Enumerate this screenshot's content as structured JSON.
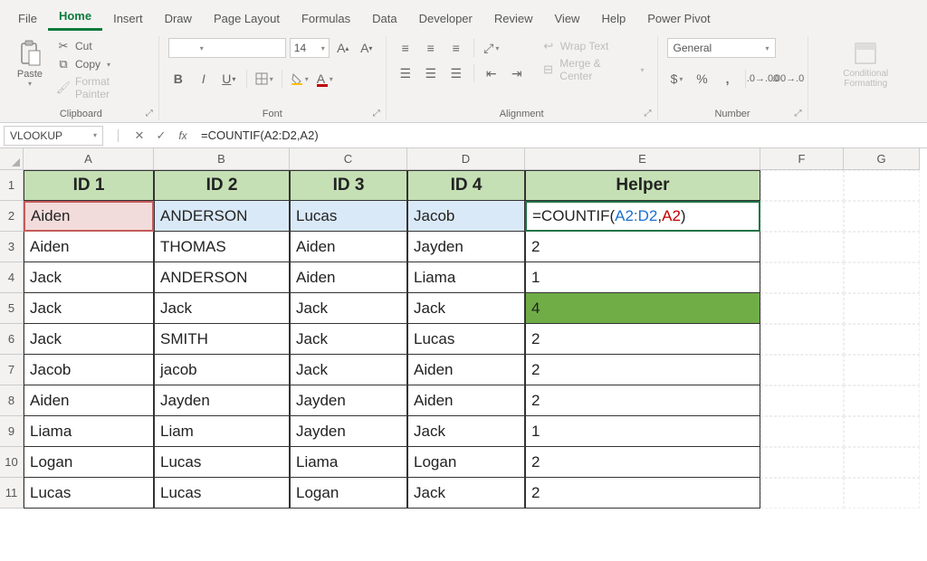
{
  "menu": [
    "File",
    "Home",
    "Insert",
    "Draw",
    "Page Layout",
    "Formulas",
    "Data",
    "Developer",
    "Review",
    "View",
    "Help",
    "Power Pivot"
  ],
  "active_tab": "Home",
  "clipboard": {
    "paste": "Paste",
    "cut": "Cut",
    "copy": "Copy",
    "format_painter": "Format Painter",
    "group": "Clipboard"
  },
  "font": {
    "size": "14",
    "group": "Font"
  },
  "alignment": {
    "wrap": "Wrap Text",
    "merge": "Merge & Center",
    "group": "Alignment"
  },
  "number": {
    "format": "General",
    "group": "Number"
  },
  "styles": {
    "cond": "Conditional Formatting"
  },
  "namebox": "VLOOKUP",
  "formula": "=COUNTIF(A2:D2,A2)",
  "columns": [
    "A",
    "B",
    "C",
    "D",
    "E",
    "F",
    "G"
  ],
  "headers": [
    "ID 1",
    "ID 2",
    "ID 3",
    "ID 4",
    "Helper"
  ],
  "e2_formula_parts": {
    "eq": "=COUNTIF(",
    "range": "A2:D2",
    "comma": ",",
    "crit": "A2",
    "close": ")"
  },
  "rows": [
    {
      "n": 2,
      "a": "Aiden",
      "b": "ANDERSON",
      "c": "Lucas",
      "d": "Jacob",
      "e": "=COUNTIF(A2:D2,A2)",
      "editing": true
    },
    {
      "n": 3,
      "a": "Aiden",
      "b": "THOMAS",
      "c": "Aiden",
      "d": "Jayden",
      "e": "2"
    },
    {
      "n": 4,
      "a": "Jack",
      "b": "ANDERSON",
      "c": "Aiden",
      "d": "Liama",
      "e": "1"
    },
    {
      "n": 5,
      "a": "Jack",
      "b": "Jack",
      "c": "Jack",
      "d": "Jack",
      "e": "4",
      "highlight": true
    },
    {
      "n": 6,
      "a": "Jack",
      "b": "SMITH",
      "c": "Jack",
      "d": "Lucas",
      "e": "2"
    },
    {
      "n": 7,
      "a": "Jacob",
      "b": "jacob",
      "c": "Jack",
      "d": "Aiden",
      "e": "2"
    },
    {
      "n": 8,
      "a": "Aiden",
      "b": "Jayden",
      "c": "Jayden",
      "d": "Aiden",
      "e": "2"
    },
    {
      "n": 9,
      "a": "Liama",
      "b": "Liam",
      "c": "Jayden",
      "d": "Jack",
      "e": "1"
    },
    {
      "n": 10,
      "a": "Logan",
      "b": "Lucas",
      "c": "Liama",
      "d": "Logan",
      "e": "2"
    },
    {
      "n": 11,
      "a": "Lucas",
      "b": "Lucas",
      "c": "Logan",
      "d": "Jack",
      "e": "2"
    }
  ],
  "chart_data": {
    "type": "table",
    "columns": [
      "ID 1",
      "ID 2",
      "ID 3",
      "ID 4",
      "Helper"
    ],
    "data": [
      [
        "Aiden",
        "ANDERSON",
        "Lucas",
        "Jacob",
        "=COUNTIF(A2:D2,A2)"
      ],
      [
        "Aiden",
        "THOMAS",
        "Aiden",
        "Jayden",
        2
      ],
      [
        "Jack",
        "ANDERSON",
        "Aiden",
        "Liama",
        1
      ],
      [
        "Jack",
        "Jack",
        "Jack",
        "Jack",
        4
      ],
      [
        "Jack",
        "SMITH",
        "Jack",
        "Lucas",
        2
      ],
      [
        "Jacob",
        "jacob",
        "Jack",
        "Aiden",
        2
      ],
      [
        "Aiden",
        "Jayden",
        "Jayden",
        "Aiden",
        2
      ],
      [
        "Liama",
        "Liam",
        "Jayden",
        "Jack",
        1
      ],
      [
        "Logan",
        "Lucas",
        "Liama",
        "Logan",
        2
      ],
      [
        "Lucas",
        "Lucas",
        "Logan",
        "Jack",
        2
      ]
    ]
  }
}
